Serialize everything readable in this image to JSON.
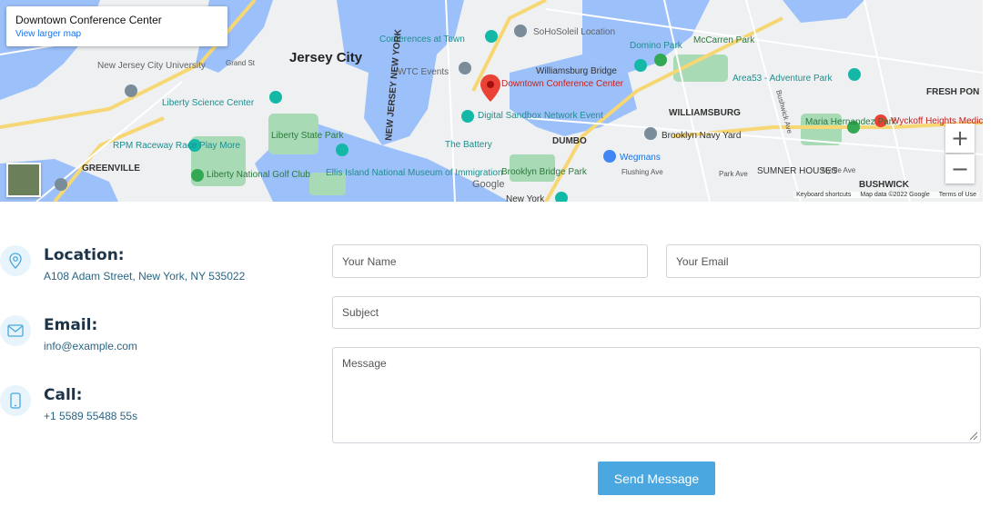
{
  "map": {
    "card_title": "Downtown Conference Center",
    "card_link": "View larger map",
    "zoom_in": "+",
    "zoom_out": "−",
    "attribution": [
      "Keyboard shortcuts",
      "Map data ©2022 Google",
      "Terms of Use"
    ],
    "google_logo": "Google",
    "labels": {
      "jersey_city": "Jersey City",
      "nj_city_university": "New Jersey City University",
      "liberty_science": "Liberty Science Center",
      "conferences": "Conferences at Town",
      "soho": "SoHoSoleil Location",
      "domino": "Domino Park",
      "mccarren": "McCarren Park",
      "wtc": "WTC Events",
      "williamsburg_bridge": "Williamsburg Bridge",
      "area53": "Area53 - Adventure Park",
      "fresh_pond": "FRESH PON",
      "downtown_pin": "Downtown Conference Center",
      "digital_sandbox": "Digital Sandbox Network Event",
      "williamsburg": "WILLIAMSBURG",
      "maria_hernandez": "Maria Hernandez Park",
      "wyckoff": "Wyckoff Heights Medical Ce",
      "rpm": "RPM Raceway Race Play More",
      "greenville": "GREENVILLE",
      "liberty_state": "Liberty State Park",
      "liberty_national": "Liberty National Golf Club",
      "ellis": "Ellis Island National Museum of Immigration",
      "battery": "The Battery",
      "dumbo": "DUMBO",
      "navy_yard": "Brooklyn Navy Yard",
      "wegmans": "Wegmans",
      "brooklyn_bridge_park": "Brooklyn Bridge Park",
      "new_york": "New York",
      "sumner": "SUMNER HOUSES",
      "bushwick": "BUSHWICK",
      "nj_ny": "NEW JERSEY NEW YORK",
      "flushing": "Flushing Ave",
      "park_ave": "Park Ave",
      "myrtle": "Myrtle Ave",
      "grand_st": "Grand St",
      "bushwick_ave": "Bushwick Ave"
    }
  },
  "contact": {
    "location_title": "Location:",
    "location_value": "A108 Adam Street, New York, NY 535022",
    "email_title": "Email:",
    "email_value": "info@example.com",
    "call_title": "Call:",
    "call_value": "+1 5589 55488 55s"
  },
  "form": {
    "name_placeholder": "Your Name",
    "email_placeholder": "Your Email",
    "subject_placeholder": "Subject",
    "message_placeholder": "Message",
    "submit_label": "Send Message"
  },
  "colors": {
    "accent": "#4aa7e0",
    "water": "#8ab4f8",
    "park": "#a8dab5",
    "pin": "#ea4335"
  }
}
